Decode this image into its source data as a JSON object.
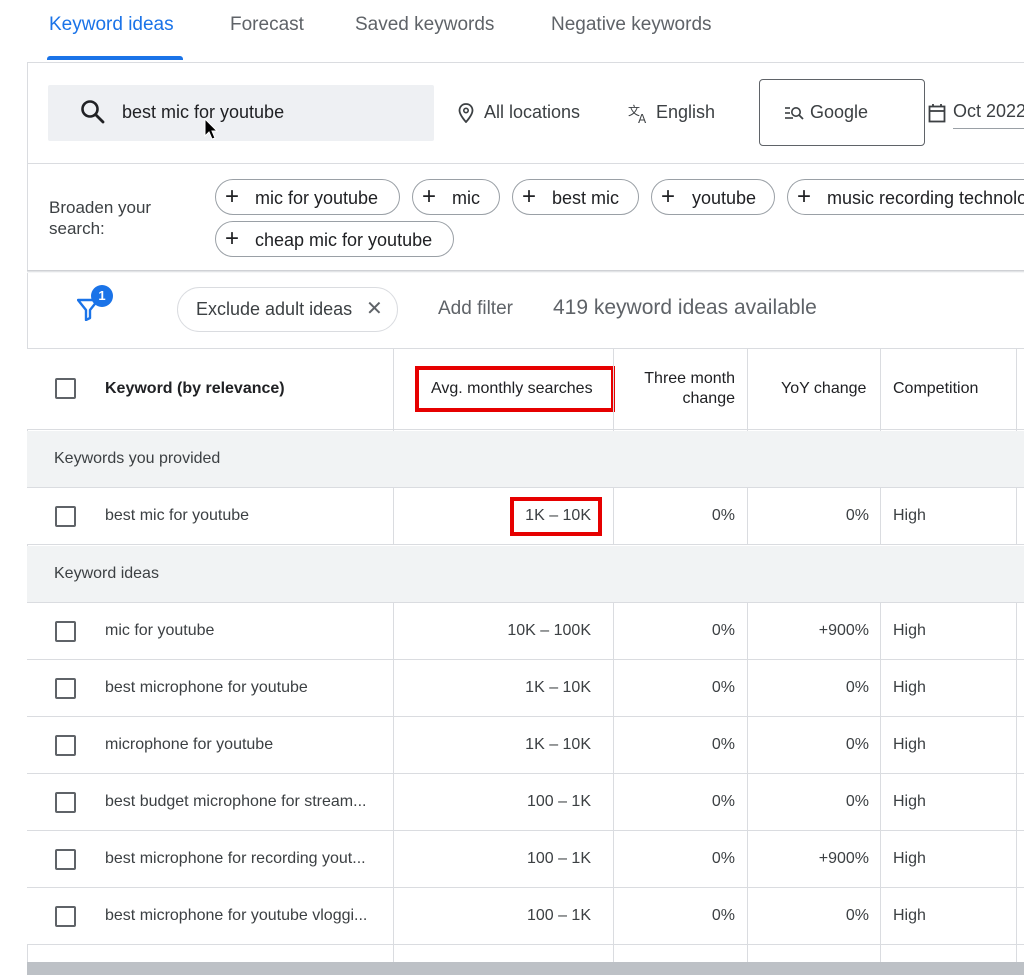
{
  "tabs": [
    {
      "label": "Keyword ideas",
      "active": true
    },
    {
      "label": "Forecast",
      "active": false
    },
    {
      "label": "Saved keywords",
      "active": false
    },
    {
      "label": "Negative keywords",
      "active": false
    }
  ],
  "search": {
    "query": "best mic for youtube",
    "location": "All locations",
    "language": "English",
    "network": "Google",
    "date": "Oct 2022"
  },
  "broaden": {
    "label": "Broaden your search:",
    "chips": [
      "mic for youtube",
      "mic",
      "best mic",
      "youtube",
      "music recording technology",
      "cheap mic for youtube"
    ]
  },
  "filters": {
    "badge_count": "1",
    "active_filter": "Exclude adult ideas",
    "add_filter_label": "Add filter",
    "ideas_count": "419 keyword ideas available"
  },
  "table": {
    "columns": {
      "keyword": "Keyword (by relevance)",
      "avg": "Avg. monthly searches",
      "three_month_line1": "Three month",
      "three_month_line2": "change",
      "yoy": "YoY change",
      "competition": "Competition"
    },
    "provided_section": "Keywords you provided",
    "provided": [
      {
        "keyword": "best mic for youtube",
        "avg": "1K – 10K",
        "three": "0%",
        "yoy": "0%",
        "comp": "High"
      }
    ],
    "ideas_section": "Keyword ideas",
    "ideas": [
      {
        "keyword": "mic for youtube",
        "avg": "10K – 100K",
        "three": "0%",
        "yoy": "+900%",
        "comp": "High"
      },
      {
        "keyword": "best microphone for youtube",
        "avg": "1K – 10K",
        "three": "0%",
        "yoy": "0%",
        "comp": "High"
      },
      {
        "keyword": "microphone for youtube",
        "avg": "1K – 10K",
        "three": "0%",
        "yoy": "0%",
        "comp": "High"
      },
      {
        "keyword": "best budget microphone for stream...",
        "avg": "100 – 1K",
        "three": "0%",
        "yoy": "0%",
        "comp": "High"
      },
      {
        "keyword": "best microphone for recording yout...",
        "avg": "100 – 1K",
        "three": "0%",
        "yoy": "+900%",
        "comp": "High"
      },
      {
        "keyword": "best microphone for youtube vloggi...",
        "avg": "100 – 1K",
        "three": "0%",
        "yoy": "0%",
        "comp": "High"
      }
    ]
  },
  "colors": {
    "accent": "#1a73e8",
    "highlight": "#e60000",
    "section_bg": "#f1f3f4"
  }
}
